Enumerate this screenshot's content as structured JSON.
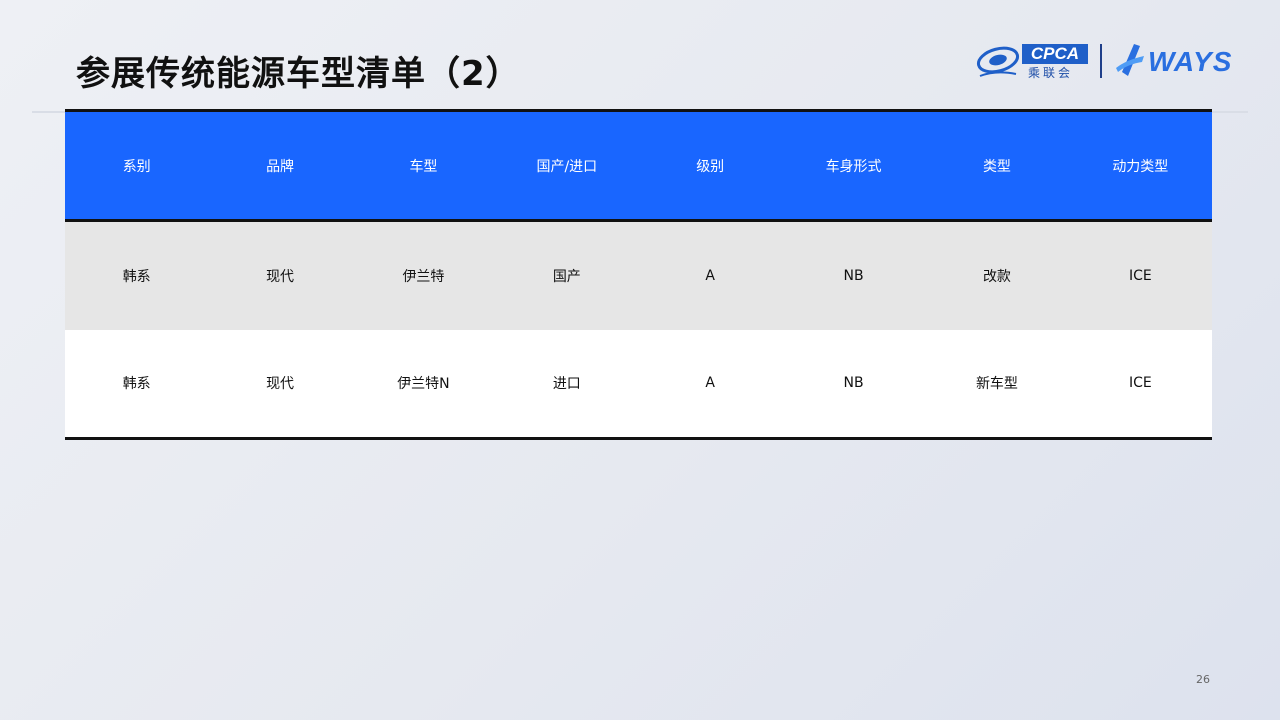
{
  "title": "参展传统能源车型清单（2）",
  "logos": {
    "cpca_text": "CPCA",
    "cpca_sub": "乘联会",
    "ways_text": "WAYS"
  },
  "table": {
    "headers": [
      "系别",
      "品牌",
      "车型",
      "国产/进口",
      "级别",
      "车身形式",
      "类型",
      "动力类型"
    ],
    "rows": [
      [
        "韩系",
        "现代",
        "伊兰特",
        "国产",
        "A",
        "NB",
        "改款",
        "ICE"
      ],
      [
        "韩系",
        "现代",
        "伊兰特N",
        "进口",
        "A",
        "NB",
        "新车型",
        "ICE"
      ]
    ]
  },
  "page_number": "26",
  "colors": {
    "header_bg": "#1966ff",
    "row_alt": "#e6e6e6",
    "border": "#111111"
  }
}
